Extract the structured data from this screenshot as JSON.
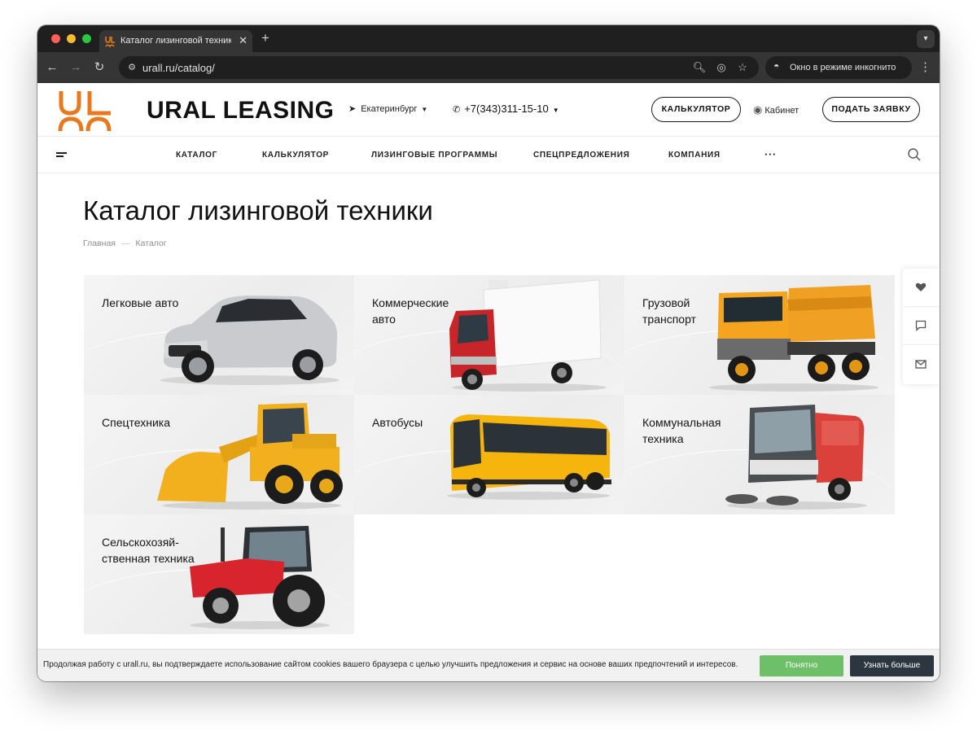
{
  "browser": {
    "tab_title": "Каталог лизинговой техники",
    "url": "urall.ru/catalog/",
    "incognito_label": "Окно в режиме инкогнито",
    "traffic_lights": [
      "#ff5f57",
      "#febc2e",
      "#28c840"
    ]
  },
  "header": {
    "brand": "URAL LEASING",
    "city": "Екатеринбург",
    "phone": "+7(343)311-15-10",
    "calculator_button": "КАЛЬКУЛЯТОР",
    "cabinet": "Кабинет",
    "apply_button": "ПОДАТЬ ЗАЯВКУ",
    "logo_color": "#e8791e"
  },
  "menu": {
    "items": [
      "КАТАЛОГ",
      "КАЛЬКУЛЯТОР",
      "ЛИЗИНГОВЫЕ ПРОГРАММЫ",
      "СПЕЦПРЕДЛОЖЕНИЯ",
      "КОМПАНИЯ"
    ],
    "more": "···"
  },
  "page": {
    "title": "Каталог лизинговой техники",
    "breadcrumb": [
      "Главная",
      "Каталог"
    ]
  },
  "catalog": [
    {
      "title": "Легковые авто",
      "icon": "car-icon"
    },
    {
      "title": "Коммерческие авто",
      "icon": "van-truck-icon"
    },
    {
      "title": "Грузовой транспорт",
      "icon": "dump-truck-icon"
    },
    {
      "title": "Спецтехника",
      "icon": "wheel-loader-icon"
    },
    {
      "title": "Автобусы",
      "icon": "bus-icon"
    },
    {
      "title": "Коммунальная техника",
      "icon": "street-sweeper-icon"
    },
    {
      "title": "Сельскохозяй-ственная техника",
      "icon": "tractor-icon"
    }
  ],
  "side_panel": [
    "heart-icon",
    "chat-icon",
    "mail-icon"
  ],
  "cookie": {
    "text": "Продолжая работу с urall.ru, вы подтверждаете использование сайтом cookies вашего браузера с целью улучшить предложения и сервис на основе ваших предпочтений и интересов.",
    "accept": "Понятно",
    "more": "Узнать больше",
    "accept_color": "#6dbf68",
    "more_color": "#2c3640"
  }
}
